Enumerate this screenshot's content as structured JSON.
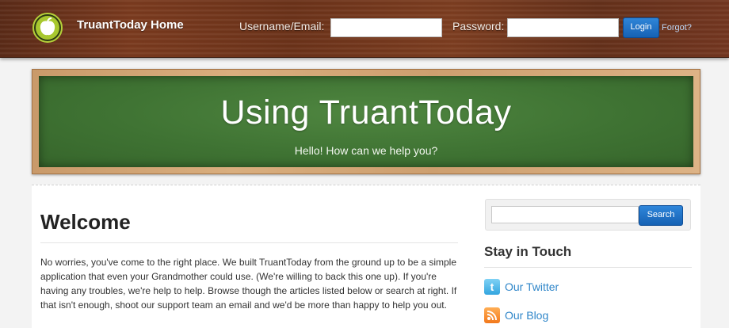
{
  "header": {
    "brand": "TruantToday Home",
    "logo_icon": "apple-icon",
    "username_label": "Username/Email:",
    "password_label": "Password:",
    "username_value": "",
    "password_value": "",
    "login_label": "Login",
    "forgot_label": "Forgot?"
  },
  "banner": {
    "title": "Using TruantToday",
    "subtitle": "Hello! How can we help you?"
  },
  "main": {
    "title": "Welcome",
    "body": "No worries, you've come to the right place. We built TruantToday from the ground up to be a simple application that even your Grandmother could use. (We're willing to back this one up). If you're having any troubles, we're help to help. Browse though the articles listed below or search at right. If that isn't enough, shoot our support team an email and we'd be more than happy to help you out."
  },
  "sidebar": {
    "search_value": "",
    "search_label": "Search",
    "stay_title": "Stay in Touch",
    "links": [
      {
        "label": "Our Twitter",
        "icon": "twitter-icon"
      },
      {
        "label": "Our Blog",
        "icon": "rss-icon"
      }
    ]
  },
  "colors": {
    "wood": "#6b3219",
    "chalkboard": "#3f7333",
    "button_blue": "#1662b4",
    "link_blue": "#2f86c9"
  }
}
